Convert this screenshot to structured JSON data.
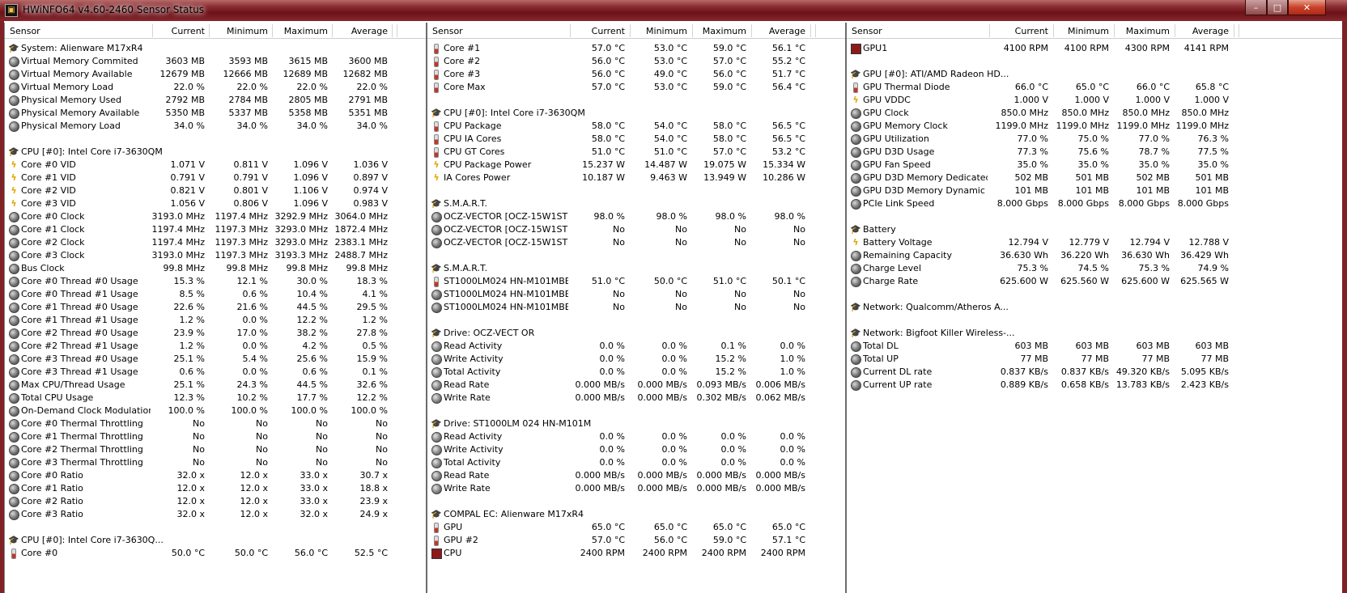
{
  "window": {
    "title": "HWiNFO64 v4.60-2460 Sensor Status",
    "min": "–",
    "max": "□",
    "close": "✕"
  },
  "columns": {
    "sensor": "Sensor",
    "current": "Current",
    "minimum": "Minimum",
    "maximum": "Maximum",
    "average": "Average"
  },
  "panels": [
    {
      "id": "p1",
      "cols": [
        182,
        252,
        330,
        404,
        478
      ],
      "rows": [
        {
          "t": "group",
          "label": "System: Alienware M17xR4"
        },
        {
          "t": "circle",
          "label": "Virtual Memory Commited",
          "v": [
            "3603 MB",
            "3593 MB",
            "3615 MB",
            "3600 MB"
          ]
        },
        {
          "t": "circle",
          "label": "Virtual Memory Available",
          "v": [
            "12679 MB",
            "12666 MB",
            "12689 MB",
            "12682 MB"
          ]
        },
        {
          "t": "circle",
          "label": "Virtual Memory Load",
          "v": [
            "22.0 %",
            "22.0 %",
            "22.0 %",
            "22.0 %"
          ]
        },
        {
          "t": "circle",
          "label": "Physical Memory Used",
          "v": [
            "2792 MB",
            "2784 MB",
            "2805 MB",
            "2791 MB"
          ]
        },
        {
          "t": "circle",
          "label": "Physical Memory Available",
          "v": [
            "5350 MB",
            "5337 MB",
            "5358 MB",
            "5351 MB"
          ]
        },
        {
          "t": "circle",
          "label": "Physical Memory Load",
          "v": [
            "34.0 %",
            "34.0 %",
            "34.0 %",
            "34.0 %"
          ]
        },
        {
          "t": "blank"
        },
        {
          "t": "group",
          "label": "CPU [#0]: Intel Core i7-3630QM"
        },
        {
          "t": "bolt",
          "label": "Core #0 VID",
          "v": [
            "1.071 V",
            "0.811 V",
            "1.096 V",
            "1.036 V"
          ]
        },
        {
          "t": "bolt",
          "label": "Core #1 VID",
          "v": [
            "0.791 V",
            "0.791 V",
            "1.096 V",
            "0.897 V"
          ]
        },
        {
          "t": "bolt",
          "label": "Core #2 VID",
          "v": [
            "0.821 V",
            "0.801 V",
            "1.106 V",
            "0.974 V"
          ]
        },
        {
          "t": "bolt",
          "label": "Core #3 VID",
          "v": [
            "1.056 V",
            "0.806 V",
            "1.096 V",
            "0.983 V"
          ]
        },
        {
          "t": "circle",
          "label": "Core #0 Clock",
          "v": [
            "3193.0 MHz",
            "1197.4 MHz",
            "3292.9 MHz",
            "3064.0 MHz"
          ]
        },
        {
          "t": "circle",
          "label": "Core #1 Clock",
          "v": [
            "1197.4 MHz",
            "1197.3 MHz",
            "3293.0 MHz",
            "1872.4 MHz"
          ]
        },
        {
          "t": "circle",
          "label": "Core #2 Clock",
          "v": [
            "1197.4 MHz",
            "1197.3 MHz",
            "3293.0 MHz",
            "2383.1 MHz"
          ]
        },
        {
          "t": "circle",
          "label": "Core #3 Clock",
          "v": [
            "3193.0 MHz",
            "1197.3 MHz",
            "3193.3 MHz",
            "2488.7 MHz"
          ]
        },
        {
          "t": "circle",
          "label": "Bus Clock",
          "v": [
            "99.8 MHz",
            "99.8 MHz",
            "99.8 MHz",
            "99.8 MHz"
          ]
        },
        {
          "t": "circle",
          "label": "Core #0 Thread #0 Usage",
          "v": [
            "15.3 %",
            "12.1 %",
            "30.0 %",
            "18.3 %"
          ]
        },
        {
          "t": "circle",
          "label": "Core #0 Thread #1 Usage",
          "v": [
            "8.5 %",
            "0.6 %",
            "10.4 %",
            "4.1 %"
          ]
        },
        {
          "t": "circle",
          "label": "Core #1 Thread #0 Usage",
          "v": [
            "22.6 %",
            "21.6 %",
            "44.5 %",
            "29.5 %"
          ]
        },
        {
          "t": "circle",
          "label": "Core #1 Thread #1 Usage",
          "v": [
            "1.2 %",
            "0.0 %",
            "12.2 %",
            "1.2 %"
          ]
        },
        {
          "t": "circle",
          "label": "Core #2 Thread #0 Usage",
          "v": [
            "23.9 %",
            "17.0 %",
            "38.2 %",
            "27.8 %"
          ]
        },
        {
          "t": "circle",
          "label": "Core #2 Thread #1 Usage",
          "v": [
            "1.2 %",
            "0.0 %",
            "4.2 %",
            "0.5 %"
          ]
        },
        {
          "t": "circle",
          "label": "Core #3 Thread #0 Usage",
          "v": [
            "25.1 %",
            "5.4 %",
            "25.6 %",
            "15.9 %"
          ]
        },
        {
          "t": "circle",
          "label": "Core #3 Thread #1 Usage",
          "v": [
            "0.6 %",
            "0.0 %",
            "0.6 %",
            "0.1 %"
          ]
        },
        {
          "t": "circle",
          "label": "Max CPU/Thread Usage",
          "v": [
            "25.1 %",
            "24.3 %",
            "44.5 %",
            "32.6 %"
          ]
        },
        {
          "t": "circle",
          "label": "Total CPU Usage",
          "v": [
            "12.3 %",
            "10.2 %",
            "17.7 %",
            "12.2 %"
          ]
        },
        {
          "t": "circle",
          "label": "On-Demand Clock Modulation",
          "v": [
            "100.0 %",
            "100.0 %",
            "100.0 %",
            "100.0 %"
          ]
        },
        {
          "t": "circle",
          "label": "Core #0 Thermal Throttling",
          "v": [
            "No",
            "No",
            "No",
            "No"
          ]
        },
        {
          "t": "circle",
          "label": "Core #1 Thermal Throttling",
          "v": [
            "No",
            "No",
            "No",
            "No"
          ]
        },
        {
          "t": "circle",
          "label": "Core #2 Thermal Throttling",
          "v": [
            "No",
            "No",
            "No",
            "No"
          ]
        },
        {
          "t": "circle",
          "label": "Core #3 Thermal Throttling",
          "v": [
            "No",
            "No",
            "No",
            "No"
          ]
        },
        {
          "t": "circle",
          "label": "Core #0 Ratio",
          "v": [
            "32.0 x",
            "12.0 x",
            "33.0 x",
            "30.7 x"
          ]
        },
        {
          "t": "circle",
          "label": "Core #1 Ratio",
          "v": [
            "12.0 x",
            "12.0 x",
            "33.0 x",
            "18.8 x"
          ]
        },
        {
          "t": "circle",
          "label": "Core #2 Ratio",
          "v": [
            "12.0 x",
            "12.0 x",
            "33.0 x",
            "23.9 x"
          ]
        },
        {
          "t": "circle",
          "label": "Core #3 Ratio",
          "v": [
            "32.0 x",
            "12.0 x",
            "32.0 x",
            "24.9 x"
          ]
        },
        {
          "t": "blank"
        },
        {
          "t": "group",
          "label": "CPU [#0]: Intel Core i7-3630Q..."
        },
        {
          "t": "therm",
          "label": "Core #0",
          "v": [
            "50.0 °C",
            "50.0 °C",
            "56.0 °C",
            "52.5 °C"
          ]
        }
      ]
    },
    {
      "id": "p2",
      "cols": [
        176,
        250,
        327,
        400,
        473
      ],
      "rows": [
        {
          "t": "therm",
          "label": "Core #1",
          "v": [
            "57.0 °C",
            "53.0 °C",
            "59.0 °C",
            "56.1 °C"
          ]
        },
        {
          "t": "therm",
          "label": "Core #2",
          "v": [
            "56.0 °C",
            "53.0 °C",
            "57.0 °C",
            "55.2 °C"
          ]
        },
        {
          "t": "therm",
          "label": "Core #3",
          "v": [
            "56.0 °C",
            "49.0 °C",
            "56.0 °C",
            "51.7 °C"
          ]
        },
        {
          "t": "therm",
          "label": "Core Max",
          "v": [
            "57.0 °C",
            "53.0 °C",
            "59.0 °C",
            "56.4 °C"
          ]
        },
        {
          "t": "blank"
        },
        {
          "t": "group",
          "label": "CPU [#0]: Intel Core i7-3630QM"
        },
        {
          "t": "therm",
          "label": "CPU Package",
          "v": [
            "58.0 °C",
            "54.0 °C",
            "58.0 °C",
            "56.5 °C"
          ]
        },
        {
          "t": "therm",
          "label": "CPU IA Cores",
          "v": [
            "58.0 °C",
            "54.0 °C",
            "58.0 °C",
            "56.5 °C"
          ]
        },
        {
          "t": "therm",
          "label": "CPU GT Cores",
          "v": [
            "51.0 °C",
            "51.0 °C",
            "57.0 °C",
            "53.2 °C"
          ]
        },
        {
          "t": "bolt",
          "label": "CPU Package Power",
          "v": [
            "15.237 W",
            "14.487 W",
            "19.075 W",
            "15.334 W"
          ]
        },
        {
          "t": "bolt",
          "label": "IA Cores Power",
          "v": [
            "10.187 W",
            "9.463 W",
            "13.949 W",
            "10.286 W"
          ]
        },
        {
          "t": "blank"
        },
        {
          "t": "group",
          "label": "S.M.A.R.T."
        },
        {
          "t": "circle",
          "label": "OCZ-VECTOR [OCZ-15W1ST2D...",
          "v": [
            "98.0 %",
            "98.0 %",
            "98.0 %",
            "98.0 %"
          ]
        },
        {
          "t": "circle",
          "label": "OCZ-VECTOR [OCZ-15W1ST2D...",
          "v": [
            "No",
            "No",
            "No",
            "No"
          ]
        },
        {
          "t": "circle",
          "label": "OCZ-VECTOR [OCZ-15W1ST2D...",
          "v": [
            "No",
            "No",
            "No",
            "No"
          ]
        },
        {
          "t": "blank"
        },
        {
          "t": "group",
          "label": "S.M.A.R.T."
        },
        {
          "t": "therm",
          "label": "ST1000LM024 HN-M101MBB [S2...",
          "v": [
            "51.0 °C",
            "50.0 °C",
            "51.0 °C",
            "50.1 °C"
          ]
        },
        {
          "t": "circle",
          "label": "ST1000LM024 HN-M101MBB [S2...",
          "v": [
            "No",
            "No",
            "No",
            "No"
          ]
        },
        {
          "t": "circle",
          "label": "ST1000LM024 HN-M101MBB [S2...",
          "v": [
            "No",
            "No",
            "No",
            "No"
          ]
        },
        {
          "t": "blank"
        },
        {
          "t": "group",
          "label": "Drive: OCZ-VECT OR"
        },
        {
          "t": "drive",
          "label": "Read Activity",
          "v": [
            "0.0 %",
            "0.0 %",
            "0.1 %",
            "0.0 %"
          ]
        },
        {
          "t": "drive",
          "label": "Write Activity",
          "v": [
            "0.0 %",
            "0.0 %",
            "15.2 %",
            "1.0 %"
          ]
        },
        {
          "t": "drive",
          "label": "Total Activity",
          "v": [
            "0.0 %",
            "0.0 %",
            "15.2 %",
            "1.0 %"
          ]
        },
        {
          "t": "drive",
          "label": "Read Rate",
          "v": [
            "0.000 MB/s",
            "0.000 MB/s",
            "0.093 MB/s",
            "0.006 MB/s"
          ]
        },
        {
          "t": "drive",
          "label": "Write Rate",
          "v": [
            "0.000 MB/s",
            "0.000 MB/s",
            "0.302 MB/s",
            "0.062 MB/s"
          ]
        },
        {
          "t": "blank"
        },
        {
          "t": "group",
          "label": "Drive: ST1000LM 024 HN-M101M"
        },
        {
          "t": "drive",
          "label": "Read Activity",
          "v": [
            "0.0 %",
            "0.0 %",
            "0.0 %",
            "0.0 %"
          ]
        },
        {
          "t": "drive",
          "label": "Write Activity",
          "v": [
            "0.0 %",
            "0.0 %",
            "0.0 %",
            "0.0 %"
          ]
        },
        {
          "t": "drive",
          "label": "Total Activity",
          "v": [
            "0.0 %",
            "0.0 %",
            "0.0 %",
            "0.0 %"
          ]
        },
        {
          "t": "drive",
          "label": "Read Rate",
          "v": [
            "0.000 MB/s",
            "0.000 MB/s",
            "0.000 MB/s",
            "0.000 MB/s"
          ]
        },
        {
          "t": "drive",
          "label": "Write Rate",
          "v": [
            "0.000 MB/s",
            "0.000 MB/s",
            "0.000 MB/s",
            "0.000 MB/s"
          ]
        },
        {
          "t": "blank"
        },
        {
          "t": "group",
          "label": "COMPAL EC: Alienware M17xR4"
        },
        {
          "t": "therm",
          "label": "GPU",
          "v": [
            "65.0 °C",
            "65.0 °C",
            "65.0 °C",
            "65.0 °C"
          ]
        },
        {
          "t": "therm",
          "label": "GPU #2",
          "v": [
            "57.0 °C",
            "56.0 °C",
            "59.0 °C",
            "57.1 °C"
          ]
        },
        {
          "t": "fan",
          "label": "CPU",
          "v": [
            "2400 RPM",
            "2400 RPM",
            "2400 RPM",
            "2400 RPM"
          ]
        }
      ]
    },
    {
      "id": "p3",
      "cols": [
        176,
        255,
        330,
        405,
        478
      ],
      "rows": [
        {
          "t": "fan",
          "label": "GPU1",
          "v": [
            "4100 RPM",
            "4100 RPM",
            "4300 RPM",
            "4141 RPM"
          ]
        },
        {
          "t": "blank"
        },
        {
          "t": "group",
          "label": "GPU [#0]: ATI/AMD Radeon HD..."
        },
        {
          "t": "therm",
          "label": "GPU Thermal Diode",
          "v": [
            "66.0 °C",
            "65.0 °C",
            "66.0 °C",
            "65.8 °C"
          ]
        },
        {
          "t": "bolt",
          "label": "GPU VDDC",
          "v": [
            "1.000 V",
            "1.000 V",
            "1.000 V",
            "1.000 V"
          ]
        },
        {
          "t": "circle",
          "label": "GPU Clock",
          "v": [
            "850.0 MHz",
            "850.0 MHz",
            "850.0 MHz",
            "850.0 MHz"
          ]
        },
        {
          "t": "circle",
          "label": "GPU Memory Clock",
          "v": [
            "1199.0 MHz",
            "1199.0 MHz",
            "1199.0 MHz",
            "1199.0 MHz"
          ]
        },
        {
          "t": "circle",
          "label": "GPU Utilization",
          "v": [
            "77.0 %",
            "75.0 %",
            "77.0 %",
            "76.3 %"
          ]
        },
        {
          "t": "circle",
          "label": "GPU D3D Usage",
          "v": [
            "77.3 %",
            "75.6 %",
            "78.7 %",
            "77.5 %"
          ]
        },
        {
          "t": "circle",
          "label": "GPU Fan Speed",
          "v": [
            "35.0 %",
            "35.0 %",
            "35.0 %",
            "35.0 %"
          ]
        },
        {
          "t": "circle",
          "label": "GPU D3D Memory Dedicated",
          "v": [
            "502 MB",
            "501 MB",
            "502 MB",
            "501 MB"
          ]
        },
        {
          "t": "circle",
          "label": "GPU D3D Memory Dynamic",
          "v": [
            "101 MB",
            "101 MB",
            "101 MB",
            "101 MB"
          ]
        },
        {
          "t": "circle",
          "label": "PCIe Link Speed",
          "v": [
            "8.000 Gbps",
            "8.000 Gbps",
            "8.000 Gbps",
            "8.000 Gbps"
          ]
        },
        {
          "t": "blank"
        },
        {
          "t": "group",
          "label": "Battery"
        },
        {
          "t": "bolt",
          "label": "Battery Voltage",
          "v": [
            "12.794 V",
            "12.779 V",
            "12.794 V",
            "12.788 V"
          ]
        },
        {
          "t": "circle",
          "label": "Remaining Capacity",
          "v": [
            "36.630 Wh",
            "36.220 Wh",
            "36.630 Wh",
            "36.429 Wh"
          ]
        },
        {
          "t": "circle",
          "label": "Charge Level",
          "v": [
            "75.3 %",
            "74.5 %",
            "75.3 %",
            "74.9 %"
          ]
        },
        {
          "t": "circle",
          "label": "Charge Rate",
          "v": [
            "625.600 W",
            "625.560 W",
            "625.600 W",
            "625.565 W"
          ]
        },
        {
          "t": "blank"
        },
        {
          "t": "group",
          "label": "Network: Qualcomm/Atheros A..."
        },
        {
          "t": "blank"
        },
        {
          "t": "group",
          "label": "Network: Bigfoot Killer Wireless-..."
        },
        {
          "t": "circle",
          "label": "Total DL",
          "v": [
            "603 MB",
            "603 MB",
            "603 MB",
            "603 MB"
          ]
        },
        {
          "t": "circle",
          "label": "Total UP",
          "v": [
            "77 MB",
            "77 MB",
            "77 MB",
            "77 MB"
          ]
        },
        {
          "t": "circle",
          "label": "Current DL rate",
          "v": [
            "0.837 KB/s",
            "0.837 KB/s",
            "49.320 KB/s",
            "5.095 KB/s"
          ]
        },
        {
          "t": "circle",
          "label": "Current UP rate",
          "v": [
            "0.889 KB/s",
            "0.658 KB/s",
            "13.783 KB/s",
            "2.423 KB/s"
          ]
        }
      ]
    }
  ]
}
